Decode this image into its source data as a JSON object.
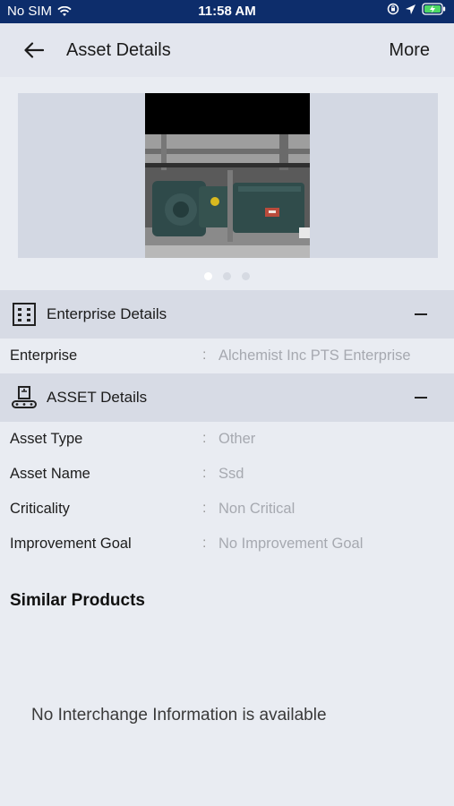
{
  "status_bar": {
    "carrier": "No SIM",
    "time": "11:58 AM"
  },
  "app_bar": {
    "title": "Asset Details",
    "more_label": "More"
  },
  "carousel": {
    "page_count": 3,
    "active_index": 0
  },
  "sections": {
    "enterprise": {
      "title": "Enterprise Details",
      "rows": [
        {
          "label": "Enterprise",
          "separator": ":",
          "value": "Alchemist Inc PTS Enterprise"
        }
      ]
    },
    "asset": {
      "title": "ASSET Details",
      "rows": [
        {
          "label": "Asset Type",
          "separator": ":",
          "value": "Other"
        },
        {
          "label": "Asset Name",
          "separator": ":",
          "value": "Ssd"
        },
        {
          "label": "Criticality",
          "separator": ":",
          "value": "Non Critical"
        },
        {
          "label": "Improvement Goal",
          "separator": ":",
          "value": "No Improvement Goal"
        }
      ]
    }
  },
  "similar_products": {
    "title": "Similar Products",
    "empty_message": "No Interchange Information is available"
  },
  "colors": {
    "status_bar": "#0d2d6b",
    "background": "#e9ecf2",
    "section_header": "#d7dbe5"
  }
}
